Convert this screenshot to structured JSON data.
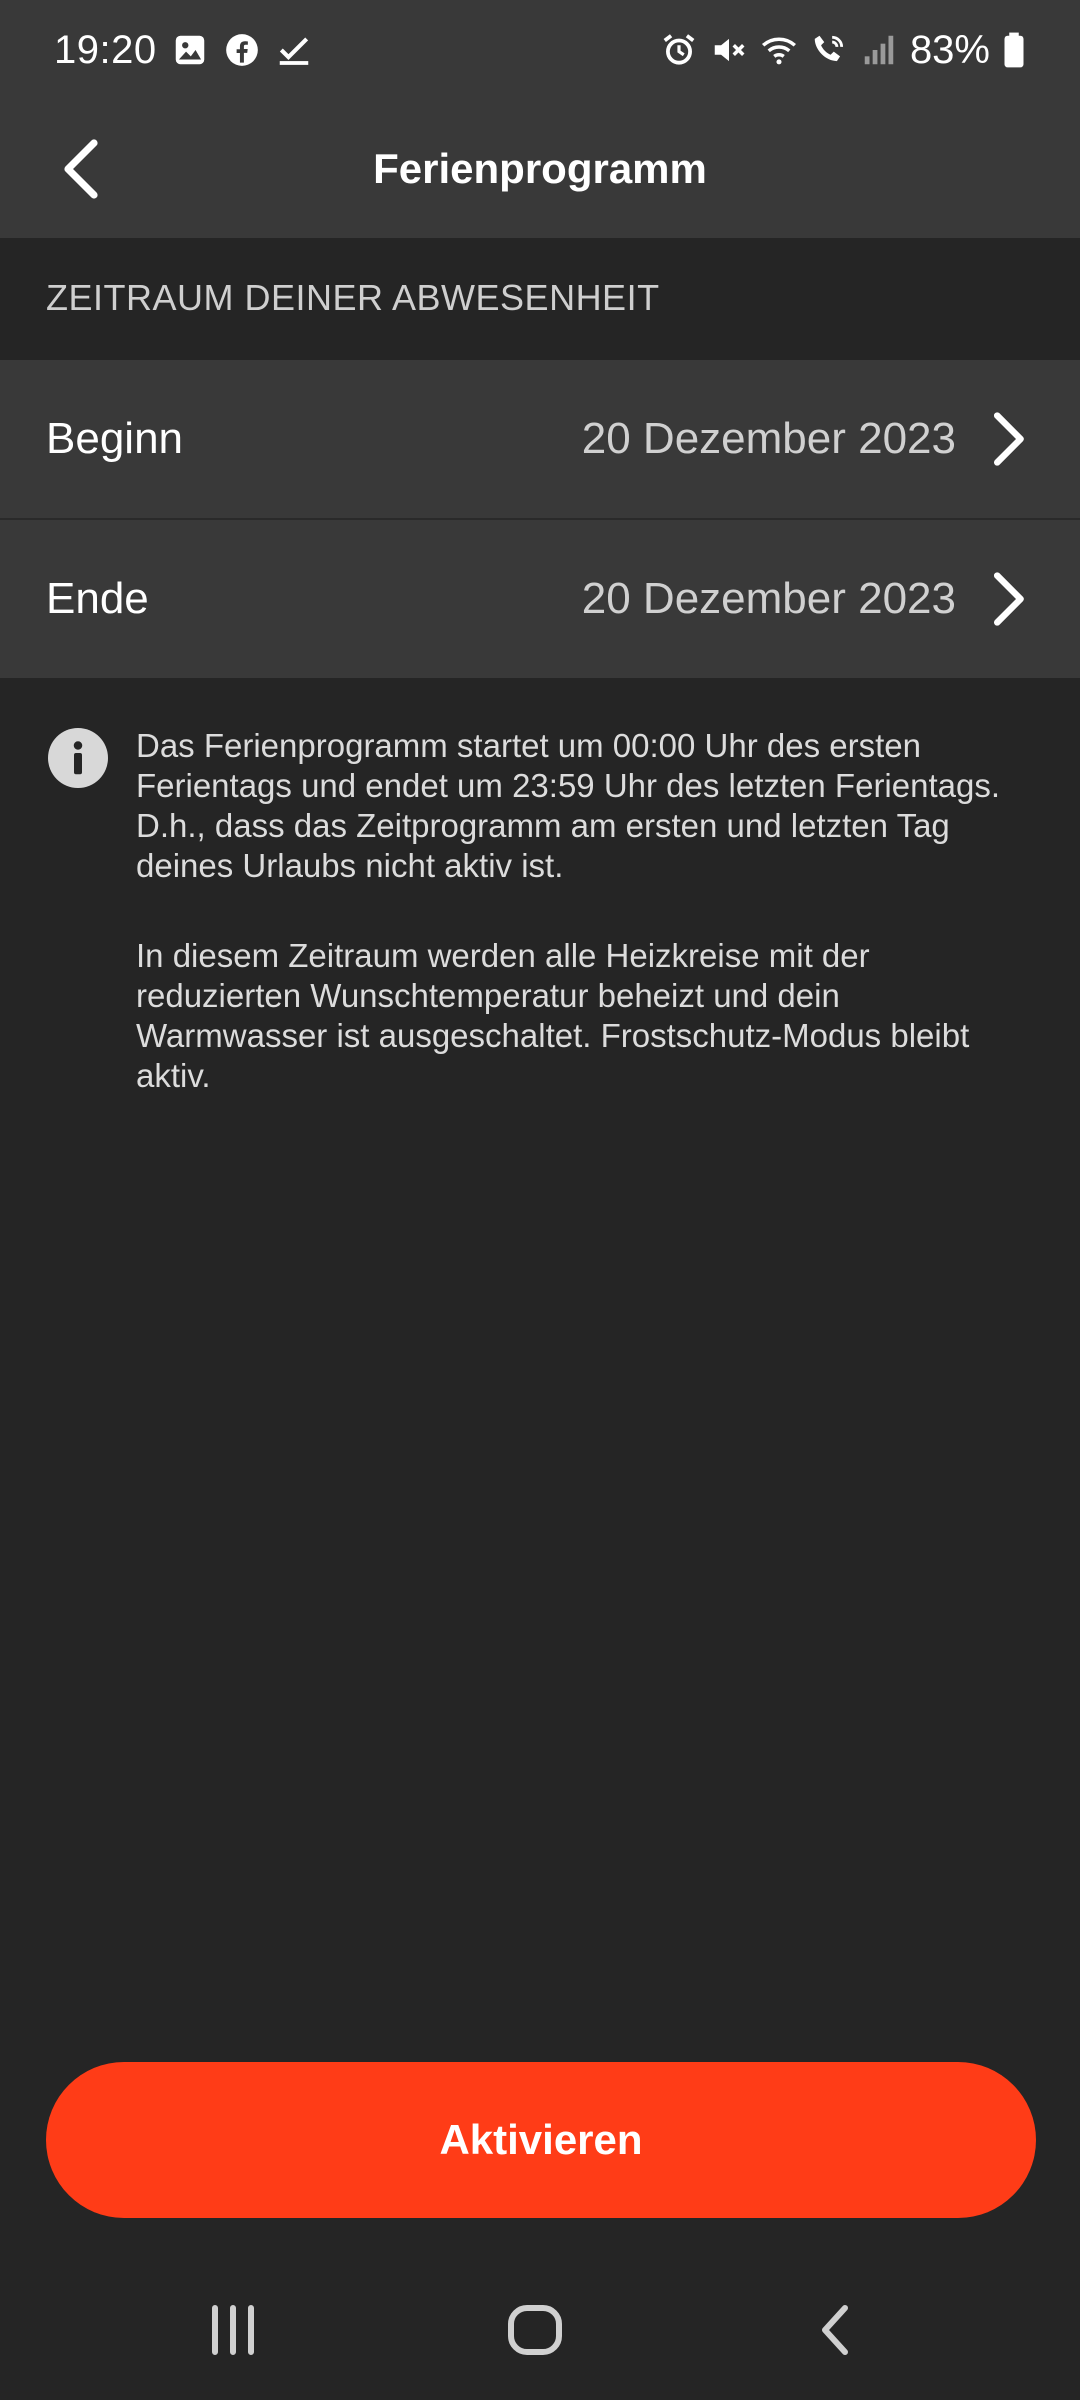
{
  "status_bar": {
    "time": "19:20",
    "battery_percent": "83%",
    "left_icons": [
      "gallery-icon",
      "facebook-icon",
      "check-icon"
    ],
    "right_icons": [
      "alarm-icon",
      "mute-icon",
      "wifi-icon",
      "wifi-call-icon",
      "signal-icon",
      "battery-icon"
    ]
  },
  "app_bar": {
    "title": "Ferienprogramm",
    "back_icon": "chevron-left-icon"
  },
  "section": {
    "header": "ZEITRAUM DEINER ABWESENHEIT"
  },
  "rows": [
    {
      "label": "Beginn",
      "value": "20 Dezember 2023"
    },
    {
      "label": "Ende",
      "value": "20 Dezember 2023"
    }
  ],
  "info": {
    "icon": "info-icon",
    "paragraph_1": "Das Ferienprogramm startet um 00:00 Uhr des ersten Ferientags und endet um 23:59 Uhr des letzten Ferientags. D.h., dass das Zeitprogramm am ersten und letzten Tag deines Urlaubs nicht aktiv ist.",
    "paragraph_2": "In diesem Zeitraum werden alle Heizkreise mit der reduzierten Wunschtemperatur beheizt und dein Warmwasser ist ausgeschaltet. Frostschutz-Modus bleibt aktiv."
  },
  "button": {
    "label": "Aktivieren",
    "color": "#ff3c17"
  },
  "colors": {
    "background": "#252525",
    "surface": "#393939",
    "accent": "#ff3c17"
  }
}
